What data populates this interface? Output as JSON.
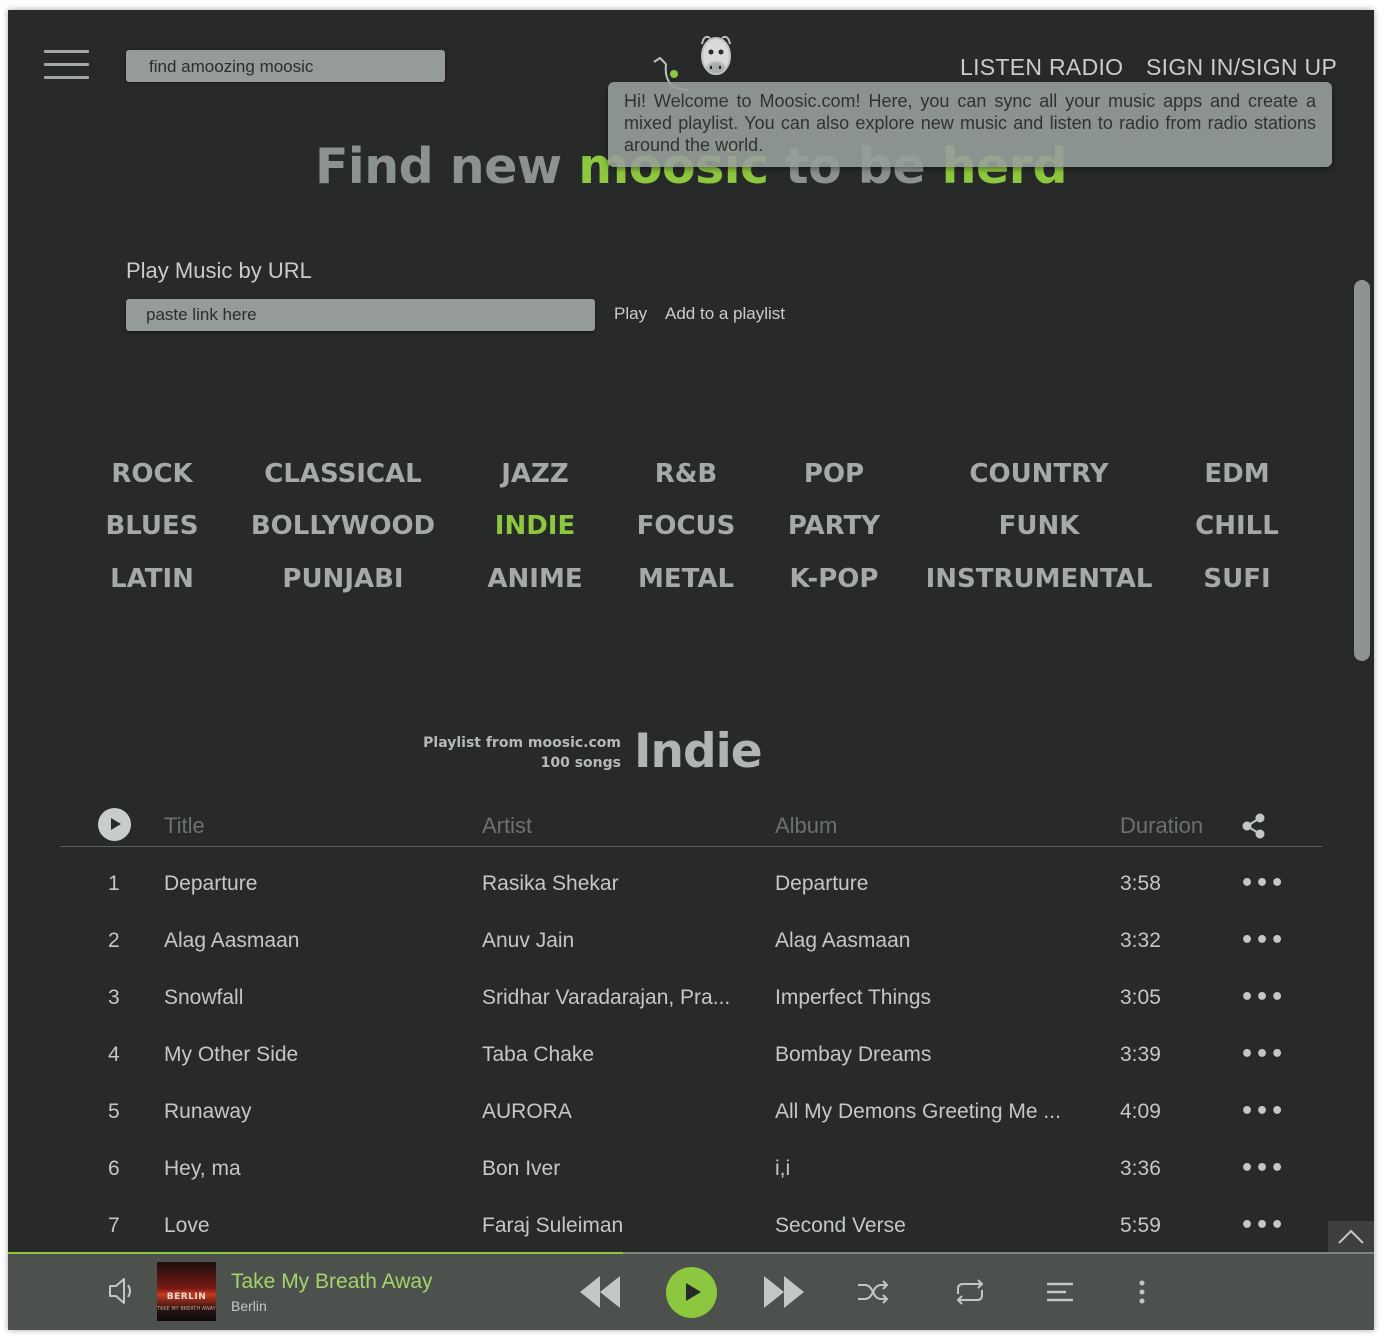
{
  "header": {
    "search_placeholder": "find amoozing moosic",
    "nav": {
      "radio": "LISTEN RADIO",
      "signin": "SIGN IN/SIGN UP"
    }
  },
  "hero": {
    "part1": "Find new ",
    "part2": "moosic",
    "part3": " to be ",
    "part4": "herd"
  },
  "tooltip": "Hi! Welcome to Moosic.com! Here, you can sync all your music apps and create a mixed playlist. You can also explore new music and listen to radio from radio stations around the world.",
  "url_section": {
    "label": "Play Music by URL",
    "placeholder": "paste link here",
    "play": "Play",
    "add": "Add to a playlist"
  },
  "genres": [
    [
      "ROCK",
      "CLASSICAL",
      "JAZZ",
      "R&B",
      "POP",
      "COUNTRY",
      "EDM"
    ],
    [
      "BLUES",
      "BOLLYWOOD",
      "INDIE",
      "FOCUS",
      "PARTY",
      "FUNK",
      "CHILL"
    ],
    [
      "LATIN",
      "PUNJABI",
      "ANIME",
      "METAL",
      "K-POP",
      "INSTRUMENTAL",
      "SUFI"
    ]
  ],
  "active_genre": "INDIE",
  "accent_color": "#8dc63f",
  "playlist": {
    "source": "Playlist from moosic.com",
    "count": "100 songs",
    "name": "Indie",
    "headers": {
      "title": "Title",
      "artist": "Artist",
      "album": "Album",
      "duration": "Duration"
    },
    "rows": [
      {
        "n": "1",
        "title": "Departure",
        "artist": "Rasika Shekar",
        "album": "Departure",
        "duration": "3:58"
      },
      {
        "n": "2",
        "title": "Alag Aasmaan",
        "artist": "Anuv Jain",
        "album": "Alag Aasmaan",
        "duration": "3:32"
      },
      {
        "n": "3",
        "title": "Snowfall",
        "artist": "Sridhar Varadarajan, Pra...",
        "album": "Imperfect Things",
        "duration": "3:05"
      },
      {
        "n": "4",
        "title": "My Other Side",
        "artist": "Taba Chake",
        "album": "Bombay Dreams",
        "duration": "3:39"
      },
      {
        "n": "5",
        "title": "Runaway",
        "artist": "AURORA",
        "album": "All My Demons Greeting Me ...",
        "duration": "4:09"
      },
      {
        "n": "6",
        "title": "Hey, ma",
        "artist": "Bon Iver",
        "album": "i,i",
        "duration": "3:36"
      },
      {
        "n": "7",
        "title": "Love",
        "artist": "Faraj Suleiman",
        "album": "Second Verse",
        "duration": "5:59"
      }
    ]
  },
  "player": {
    "title": "Take My Breath Away",
    "artist": "Berlin",
    "art_text": "BERLIN",
    "art_subtext": "TAKE MY BREATH AWAY",
    "progress": 0.45
  }
}
